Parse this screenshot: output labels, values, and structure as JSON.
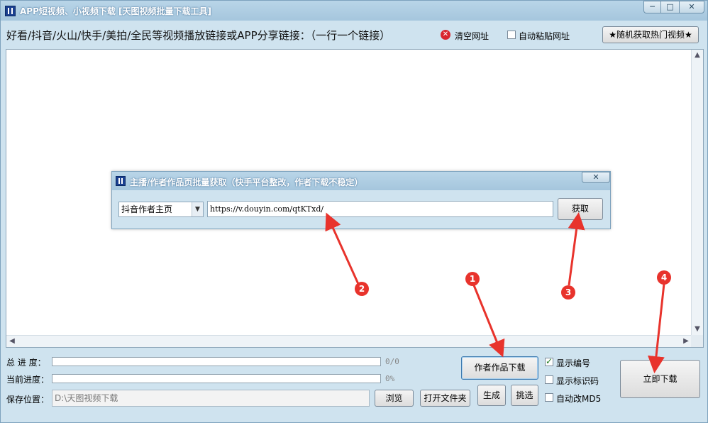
{
  "window": {
    "title": "APP短视频、小视频下载 [天图视频批量下载工具]",
    "min": "─",
    "max": "□",
    "close": "✕"
  },
  "top": {
    "hint": "好看/抖音/火山/快手/美拍/全民等视频播放链接或APP分享链接：（一行一个链接）",
    "clear_url": "清空网址",
    "auto_paste": "自动粘贴网址",
    "auto_paste_checked": false,
    "random_hot": "★随机获取热门视频★"
  },
  "dialog": {
    "title": "主播/作者作品页批量获取（快手平台整改，作者下载不稳定）",
    "close": "✕",
    "select_value": "抖音作者主页",
    "url_value": "https://v.douyin.com/qtKTxd/",
    "fetch_button": "获取"
  },
  "bottom": {
    "total_progress_label": "总 进 度：",
    "total_progress_text": "0/0",
    "total_progress_value": 0,
    "current_progress_label": "当前进度：",
    "current_progress_text": "0%",
    "current_progress_value": 0,
    "save_label": "保存位置：",
    "save_path": "D:\\天图视频下载",
    "browse": "浏览",
    "open_folder": "打开文件夹",
    "author_download": "作者作品下载",
    "generate": "生成",
    "pick": "挑选",
    "show_number": "显示编号",
    "show_number_checked": true,
    "show_watermark": "显示标识码",
    "show_watermark_checked": false,
    "auto_md5": "自动改MD5",
    "auto_md5_checked": false,
    "download_now": "立即下载"
  },
  "annotations": [
    "1",
    "2",
    "3",
    "4"
  ],
  "colors": {
    "window_bg": "#cfe3ef",
    "titlebar": "#a5c6dd",
    "annotation_red": "#e8332c"
  }
}
